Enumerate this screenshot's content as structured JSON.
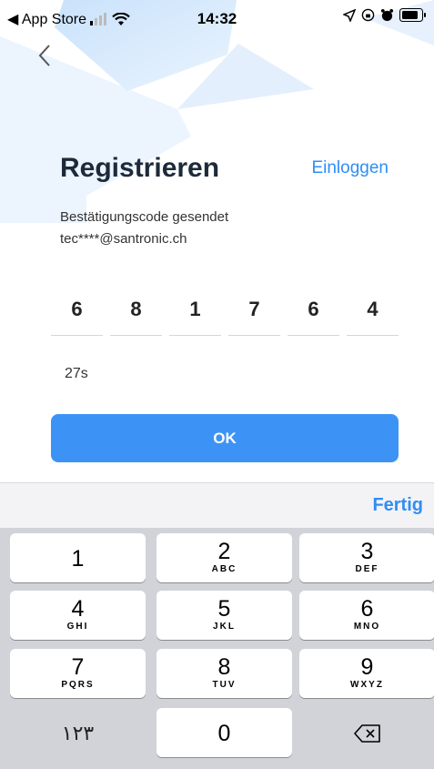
{
  "status_bar": {
    "back_app": "◀ App Store",
    "time": "14:32"
  },
  "screen": {
    "title": "Registrieren",
    "login_link": "Einloggen",
    "sent_message": "Bestätigungscode gesendet",
    "email": "tec****@santronic.ch",
    "code_digits": [
      "6",
      "8",
      "1",
      "7",
      "6",
      "4"
    ],
    "countdown": "27s",
    "ok_label": "OK"
  },
  "keyboard": {
    "done_label": "Fertig",
    "keys": [
      {
        "num": "1",
        "letters": ""
      },
      {
        "num": "2",
        "letters": "ABC"
      },
      {
        "num": "3",
        "letters": "DEF"
      },
      {
        "num": "4",
        "letters": "GHI"
      },
      {
        "num": "5",
        "letters": "JKL"
      },
      {
        "num": "6",
        "letters": "MNO"
      },
      {
        "num": "7",
        "letters": "PQRS"
      },
      {
        "num": "8",
        "letters": "TUV"
      },
      {
        "num": "9",
        "letters": "WXYZ"
      },
      {
        "num": "0",
        "letters": ""
      }
    ],
    "alt_label": "١٢٣"
  },
  "colors": {
    "accent": "#3d93f5",
    "link": "#2f8ef5",
    "keyboard_bg": "#d1d3d9"
  }
}
